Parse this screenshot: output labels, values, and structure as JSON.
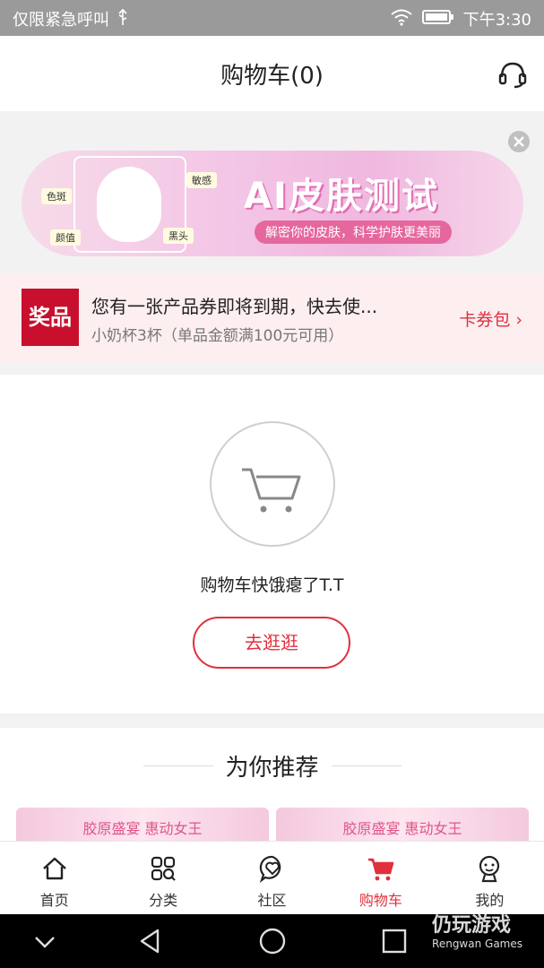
{
  "status_bar": {
    "carrier": "仅限紧急呼叫",
    "time": "下午3:30"
  },
  "header": {
    "title": "购物车(0)"
  },
  "banner": {
    "title": "AI皮肤测试",
    "subtitle": "解密你的皮肤，科学护肤更美丽",
    "tags": [
      "色斑",
      "颜值",
      "敏感",
      "黑头"
    ]
  },
  "coupon": {
    "logo": "奖品",
    "title": "您有一张产品券即将到期，快去使...",
    "subtitle": "小奶杯3杯（单品金额满100元可用）",
    "link": "卡券包 ›"
  },
  "empty_cart": {
    "message": "购物车快饿瘪了T.T",
    "button": "去逛逛"
  },
  "recommend": {
    "title": "为你推荐",
    "cards": [
      "胶原盛宴 惠动女王",
      "胶原盛宴 惠动女王"
    ]
  },
  "tabbar": {
    "items": [
      {
        "label": "首页",
        "icon": "home-icon"
      },
      {
        "label": "分类",
        "icon": "category-icon"
      },
      {
        "label": "社区",
        "icon": "community-icon"
      },
      {
        "label": "购物车",
        "icon": "cart-icon",
        "active": true
      },
      {
        "label": "我的",
        "icon": "profile-icon"
      }
    ]
  },
  "colors": {
    "accent": "#e0303d",
    "coupon_bg": "#fdeef0"
  },
  "watermark": {
    "title": "仍玩游戏",
    "subtitle": "Rengwan Games"
  }
}
